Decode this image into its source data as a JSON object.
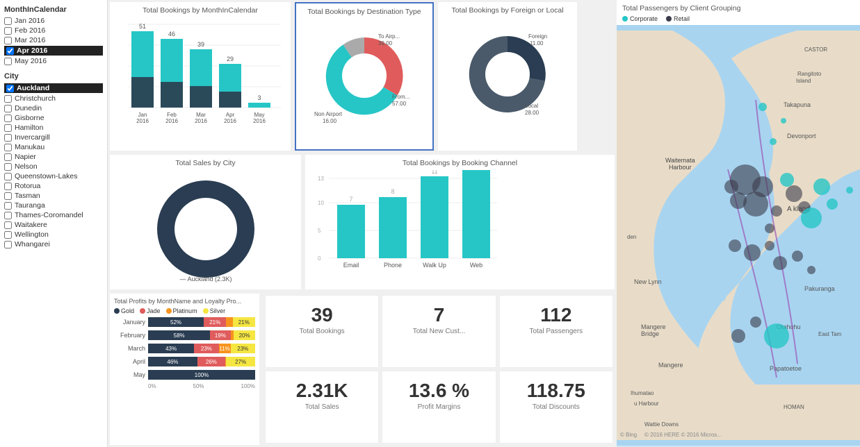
{
  "filters": {
    "month_title": "MonthInCalendar",
    "months": [
      {
        "label": "Jan 2016",
        "checked": false
      },
      {
        "label": "Feb 2016",
        "checked": false
      },
      {
        "label": "Mar 2016",
        "checked": false
      },
      {
        "label": "Apr 2016",
        "checked": true,
        "selected": true
      },
      {
        "label": "May 2016",
        "checked": false
      }
    ],
    "city_title": "City",
    "cities": [
      {
        "label": "Auckland",
        "selected": true
      },
      {
        "label": "Christchurch",
        "selected": false
      },
      {
        "label": "Dunedin",
        "selected": false
      },
      {
        "label": "Gisborne",
        "selected": false
      },
      {
        "label": "Hamilton",
        "selected": false
      },
      {
        "label": "Invercargill",
        "selected": false
      },
      {
        "label": "Manukau",
        "selected": false
      },
      {
        "label": "Napier",
        "selected": false
      },
      {
        "label": "Nelson",
        "selected": false
      },
      {
        "label": "Queenstown-Lakes",
        "selected": false
      },
      {
        "label": "Rotorua",
        "selected": false
      },
      {
        "label": "Tasman",
        "selected": false
      },
      {
        "label": "Tauranga",
        "selected": false
      },
      {
        "label": "Thames-Coromandel",
        "selected": false
      },
      {
        "label": "Waitakere",
        "selected": false
      },
      {
        "label": "Wellington",
        "selected": false
      },
      {
        "label": "Whangarei",
        "selected": false
      }
    ]
  },
  "bookings_by_month": {
    "title": "Total Bookings by MonthInCalendar",
    "bars": [
      {
        "month": "Jan\n2016",
        "value": 51
      },
      {
        "month": "Feb\n2016",
        "value": 46
      },
      {
        "month": "Mar\n2016",
        "value": 39
      },
      {
        "month": "Apr\n2016",
        "value": 29
      },
      {
        "month": "May\n2016",
        "value": 3
      }
    ]
  },
  "bookings_by_destination": {
    "title": "Total Bookings by Destination Type",
    "segments": [
      {
        "label": "To Airp...\n39.00",
        "value": 39,
        "color": "#E05C5C"
      },
      {
        "label": "From...\n57.00",
        "value": 57,
        "color": "#26C6C6"
      },
      {
        "label": "Non Airport\n16.00",
        "value": 16,
        "color": "#aaaaaa"
      }
    ]
  },
  "bookings_foreign_local": {
    "title": "Total Bookings by Foreign or Local",
    "segments": [
      {
        "label": "Foreign\n11.00",
        "value": 11,
        "color": "#2a3d52"
      },
      {
        "label": "Local\n28.00",
        "value": 28,
        "color": "#4a4a4a"
      }
    ]
  },
  "sales_by_city": {
    "title": "Total Sales by City",
    "label": "Auckland (2.3K)"
  },
  "bookings_by_channel": {
    "title": "Total Bookings by Booking Channel",
    "bars": [
      {
        "label": "Email",
        "value": 7
      },
      {
        "label": "Phone",
        "value": 8
      },
      {
        "label": "Walk Up",
        "value": 11
      },
      {
        "label": "Web",
        "value": 13
      }
    ]
  },
  "kpis": [
    {
      "value": "39",
      "label": "Total Bookings"
    },
    {
      "value": "7",
      "label": "Total New Cust..."
    },
    {
      "value": "112",
      "label": "Total Passengers"
    },
    {
      "value": "2.31K",
      "label": "Total Sales"
    },
    {
      "value": "13.6 %",
      "label": "Profit Margins"
    },
    {
      "value": "118.75",
      "label": "Total Discounts"
    }
  ],
  "profits_by_month": {
    "title": "Total Profits by MonthName and Loyalty Pro...",
    "legend": [
      {
        "label": "Gold",
        "color": "#2a3d52"
      },
      {
        "label": "Jade",
        "color": "#E05C5C"
      },
      {
        "label": "Platinum",
        "color": "#F7941D"
      },
      {
        "label": "Silver",
        "color": "#F5E642"
      }
    ],
    "rows": [
      {
        "month": "January",
        "gold": 52,
        "jade": 21,
        "platinum": 6,
        "silver": 21
      },
      {
        "month": "February",
        "gold": 58,
        "jade": 19,
        "platinum": 3,
        "silver": 20
      },
      {
        "month": "March",
        "gold": 43,
        "jade": 23,
        "platinum": 11,
        "silver": 23
      },
      {
        "month": "April",
        "gold": 46,
        "jade": 26,
        "platinum": 1,
        "silver": 27
      },
      {
        "month": "May",
        "gold": 100,
        "jade": 0,
        "platinum": 0,
        "silver": 0
      }
    ]
  },
  "map": {
    "title": "Total Passengers by Client Grouping",
    "legend": [
      {
        "label": "Corporate",
        "color": "#26C6C6"
      },
      {
        "label": "Retail",
        "color": "#3a3a4a"
      }
    ]
  },
  "colors": {
    "teal": "#26C6C6",
    "dark": "#2a3d52",
    "red": "#E05C5C",
    "orange": "#F7941D",
    "yellow": "#F5E642",
    "gray": "#aaaaaa"
  }
}
